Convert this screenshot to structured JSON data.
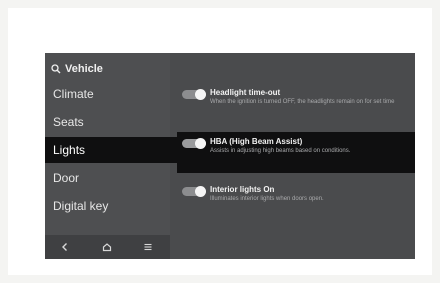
{
  "header": {
    "title": "Vehicle",
    "icon": "search-icon"
  },
  "sidebar": {
    "items": [
      {
        "label": "Climate",
        "active": false
      },
      {
        "label": "Seats",
        "active": false
      },
      {
        "label": "Lights",
        "active": true
      },
      {
        "label": "Door",
        "active": false
      },
      {
        "label": "Digital key",
        "active": false
      }
    ]
  },
  "bottom_bar": {
    "buttons": [
      "back-icon",
      "home-icon",
      "menu-icon"
    ]
  },
  "settings": [
    {
      "title": "Headlight time-out",
      "description": "When the ignition is turned OFF, the headlights remain on for set time",
      "enabled": true
    },
    {
      "title": "HBA (High Beam Assist)",
      "description": "Assists in adjusting high beams based on conditions.",
      "enabled": true
    },
    {
      "title": "Interior lights On",
      "description": "Illuminates interior lights when doors open.",
      "enabled": true
    }
  ],
  "colors": {
    "screen_background": "#4a4b4d",
    "active_background": "#0f0f10",
    "toggle_knob": "#f5f5f5"
  }
}
